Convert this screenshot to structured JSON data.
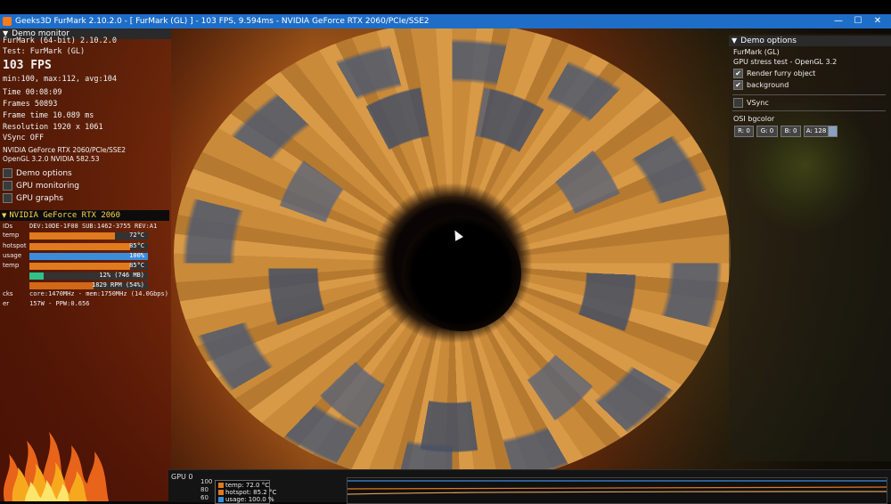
{
  "window": {
    "title": "Geeks3D FurMark 2.10.2.0 - [ FurMark (GL) ] - 103 FPS, 9.594ms - NVIDIA GeForce RTX 2060/PCIe/SSE2",
    "minimize": "—",
    "maximize": "☐",
    "close": "✕"
  },
  "left_panel": {
    "header": "Demo monitor",
    "app_line": "FurMark (64-bit) 2.10.2.0",
    "test_line": "Test: FurMark (GL)",
    "fps": "103 FPS",
    "minmax": "min:100, max:112, avg:104",
    "time": "Time       00:08:09",
    "frames": "Frames      50893",
    "frame_time": "Frame time  10.089 ms",
    "resolution": "Resolution  1920 x 1061",
    "vsync": "VSync       OFF",
    "renderer": "NVIDIA GeForce RTX 2060/PCIe/SSE2",
    "opengl": "OpenGL 3.2.0 NVIDIA 582.53",
    "options": [
      {
        "label": "Demo options",
        "checked": false
      },
      {
        "label": "GPU monitoring",
        "checked": false
      },
      {
        "label": "GPU graphs",
        "checked": false
      }
    ]
  },
  "gpu_monitor": {
    "header": "NVIDIA GeForce RTX 2060",
    "ids_label": "IDs",
    "ids_value": "DEV:10DE-1F08 SUB:1462-3755 REV:A1",
    "rows": [
      {
        "label": "temp",
        "value": "72°C",
        "percent": 72,
        "color": "#e07a1e"
      },
      {
        "label": "hotspot",
        "value": "85°C",
        "percent": 85,
        "color": "#e07a1e"
      },
      {
        "label": "usage",
        "value": "100%",
        "percent": 100,
        "color": "#3c8cdc"
      },
      {
        "label": "temp",
        "value": "85°C",
        "percent": 85,
        "color": "#e07a1e"
      },
      {
        "label": "",
        "value": "12% (746 MB)",
        "percent": 12,
        "color": "#2ec28a"
      },
      {
        "label": "",
        "value": "1829 RPM (54%)",
        "percent": 54,
        "color": "#d06818"
      }
    ],
    "clocks_label": "cks",
    "clocks_value": "core:1470MHz - mem:1750MHz (14.0Gbps)",
    "power_label": "er",
    "power_value": "157W - PPW:0.656"
  },
  "right_panel": {
    "header": "Demo options",
    "line1": "FurMark (GL)",
    "line2": "GPU stress test - OpenGL 3.2",
    "render_furry": {
      "label": "Render furry object",
      "checked": true
    },
    "background": {
      "label": "background",
      "checked": true
    },
    "vsync": {
      "label": "VSync",
      "checked": false
    },
    "osi_label": "OSI bgcolor",
    "rgba": [
      "R: 0",
      "G: 0",
      "B: 0",
      "A: 128"
    ]
  },
  "bottom_monitor": {
    "label": "GPU 0",
    "axis": [
      "100",
      "80",
      "60"
    ],
    "legend": [
      {
        "text": "temp: 72.0 °C",
        "color": "#e07a1e"
      },
      {
        "text": "hotspot: 85.2 °C",
        "color": "#e07a1e"
      },
      {
        "text": "usage: 100.0 %",
        "color": "#3c8cdc"
      }
    ]
  },
  "colors": {
    "title_bar": "#1e6ec8",
    "accent_orange": "#e07a1e",
    "accent_blue": "#3c8cdc"
  }
}
